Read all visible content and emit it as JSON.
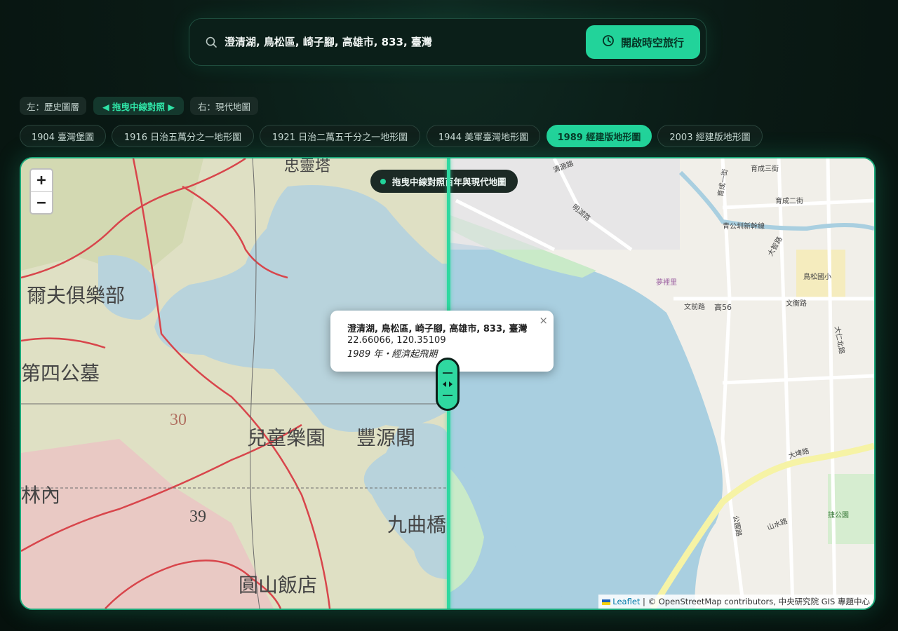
{
  "search": {
    "value": "澄清湖, 鳥松區, 崎子腳, 高雄市, 833, 臺灣",
    "button_label": "開啟時空旅行"
  },
  "hints": {
    "left": "左：歷史圖層",
    "center": "◀ 拖曳中線對照 ▶",
    "right": "右：現代地圖"
  },
  "layers": [
    {
      "label": "1904 臺灣堡圖"
    },
    {
      "label": "1916 日治五萬分之一地形圖"
    },
    {
      "label": "1921 日治二萬五千分之一地形圖"
    },
    {
      "label": "1944 美軍臺灣地形圖"
    },
    {
      "label": "1989 經建版地形圖",
      "active": true
    },
    {
      "label": "2003 經建版地形圖"
    }
  ],
  "map": {
    "zoom_in": "+",
    "zoom_out": "−",
    "hint": "拖曳中線對照百年與現代地圖",
    "popup": {
      "title": "澄清湖, 鳥松區, 崎子腳, 高雄市, 833, 臺灣",
      "coords": "22.66066, 120.35109",
      "period": "1989 年・經濟起飛期",
      "close": "×"
    },
    "attribution": {
      "leaflet": "Leaflet",
      "rest": " | © OpenStreetMap contributors, 中央研究院 GIS 專題中心"
    },
    "historic_labels": [
      "爾夫俱樂部",
      "第四公墓",
      "兒童樂園",
      "豐源閣",
      "九曲橋",
      "圓山飯店",
      "林內",
      "忠靈塔",
      "30",
      "39"
    ],
    "modern_labels": [
      "青公圳新幹線",
      "鳥松國小",
      "大埤路",
      "文前路",
      "高56",
      "文衡路",
      "大智路",
      "育成三街",
      "育成二街",
      "育成一街",
      "清源路",
      "明湖路",
      "夢裡里",
      "大仁北路",
      "捷公園",
      "公園路",
      "山水路"
    ]
  },
  "colors": {
    "accent": "#22d39a",
    "background": "#0a1a15"
  }
}
